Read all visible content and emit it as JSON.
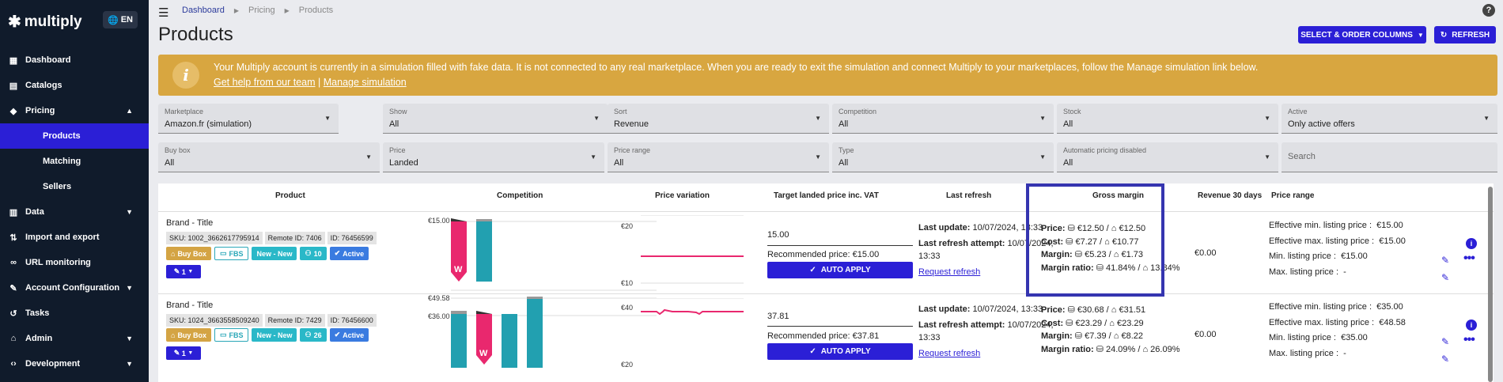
{
  "sidebar": {
    "logo": "multiply",
    "lang": "EN",
    "items": [
      {
        "label": "Dashboard",
        "icon": "dashboard-icon"
      },
      {
        "label": "Catalogs",
        "icon": "folder-icon"
      },
      {
        "label": "Pricing",
        "icon": "tag-icon"
      },
      {
        "label": "Products"
      },
      {
        "label": "Matching"
      },
      {
        "label": "Sellers"
      },
      {
        "label": "Data",
        "icon": "chart-icon"
      },
      {
        "label": "Import and export",
        "icon": "import-export-icon"
      },
      {
        "label": "URL monitoring",
        "icon": "link-icon"
      },
      {
        "label": "Account Configuration",
        "icon": "wrench-icon"
      },
      {
        "label": "Tasks",
        "icon": "history-icon"
      },
      {
        "label": "Admin",
        "icon": "bank-icon"
      },
      {
        "label": "Development",
        "icon": "code-icon"
      }
    ]
  },
  "breadcrumb": [
    "Dashboard",
    "Pricing",
    "Products"
  ],
  "page_title": "Products",
  "toolbar": {
    "select_columns": "SELECT & ORDER COLUMNS",
    "refresh": "REFRESH"
  },
  "banner": {
    "text": "Your Multiply account is currently in a simulation filled with fake data. It is not connected to any real marketplace. When you are ready to exit the simulation and connect Multiply to your marketplaces, follow the Manage simulation link below.",
    "link_help": "Get help from our team",
    "separator": "|",
    "link_manage": "Manage simulation"
  },
  "filters": [
    {
      "label": "Marketplace",
      "value": "Amazon.fr (simulation)"
    },
    {
      "label": "Show",
      "value": "All"
    },
    {
      "label": "Sort",
      "value": "Revenue"
    },
    {
      "label": "Competition",
      "value": "All"
    },
    {
      "label": "Stock",
      "value": "All"
    },
    {
      "label": "Active",
      "value": "Only active offers"
    },
    {
      "label": "Buy box",
      "value": "All"
    },
    {
      "label": "Price",
      "value": "Landed"
    },
    {
      "label": "Price range",
      "value": "All"
    },
    {
      "label": "Type",
      "value": "All"
    },
    {
      "label": "Automatic pricing disabled",
      "value": "All"
    }
  ],
  "search_placeholder": "Search",
  "columns": [
    "Product",
    "Competition",
    "Price variation",
    "Target landed price inc. VAT",
    "Last refresh",
    "Gross margin",
    "Revenue 30 days",
    "Price range"
  ],
  "rows": [
    {
      "title": "Brand - Title",
      "sku": "SKU: 1002_3662617795914",
      "remote_id": "Remote ID: 7406",
      "id": "ID: 76456599",
      "badges": {
        "buybox": "Buy Box",
        "fbs": "FBS",
        "new": "New - New",
        "count": "10",
        "active": "Active"
      },
      "tag": "1",
      "comp_axis": [
        "€15.00"
      ],
      "var_axis": [
        "€20",
        "€10"
      ],
      "target": "15.00",
      "recommended": "Recommended price: €15.00",
      "auto": "AUTO APPLY",
      "last_update_label": "Last update:",
      "last_update": "10/07/2024, 13:33",
      "last_attempt_label": "Last refresh attempt:",
      "last_attempt": "10/07/2024, 13:33",
      "request": "Request refresh",
      "margin": {
        "price_label": "Price:",
        "price": "€12.50 / ",
        "price2": "€12.50",
        "cost_label": "Cost:",
        "cost": "€7.27 / ",
        "cost2": "€10.77",
        "margin_label": "Margin:",
        "margin": "€5.23 / ",
        "margin2": "€1.73",
        "ratio_label": "Margin ratio:",
        "ratio": "41.84% / ",
        "ratio2": "13.84%"
      },
      "revenue": "€0.00",
      "range": {
        "eff_min_label": "Effective min. listing price :",
        "eff_min": "€15.00",
        "eff_max_label": "Effective max. listing price :",
        "eff_max": "€15.00",
        "min_label": "Min. listing price :",
        "min": "€15.00",
        "max_label": "Max. listing price :",
        "max": "-"
      }
    },
    {
      "title": "Brand - Title",
      "sku": "SKU: 1024_3663558509240",
      "remote_id": "Remote ID: 7429",
      "id": "ID: 76456600",
      "badges": {
        "buybox": "Buy Box",
        "fbs": "FBS",
        "new": "New - New",
        "count": "26",
        "active": "Active"
      },
      "tag": "1",
      "comp_axis": [
        "€49.58",
        "€36.00"
      ],
      "var_axis": [
        "€40",
        "€20"
      ],
      "target": "37.81",
      "recommended": "Recommended price: €37.81",
      "auto": "AUTO APPLY",
      "last_update_label": "Last update:",
      "last_update": "10/07/2024, 13:33",
      "last_attempt_label": "Last refresh attempt:",
      "last_attempt": "10/07/2024, 13:33",
      "request": "Request refresh",
      "margin": {
        "price_label": "Price:",
        "price": "€30.68 / ",
        "price2": "€31.51",
        "cost_label": "Cost:",
        "cost": "€23.29 / ",
        "cost2": "€23.29",
        "margin_label": "Margin:",
        "margin": "€7.39 / ",
        "margin2": "€8.22",
        "ratio_label": "Margin ratio:",
        "ratio": "24.09% / ",
        "ratio2": "26.09%"
      },
      "revenue": "€0.00",
      "range": {
        "eff_min_label": "Effective min. listing price :",
        "eff_min": "€35.00",
        "eff_max_label": "Effective max. listing price :",
        "eff_max": "€48.58",
        "min_label": "Min. listing price :",
        "min": "€35.00",
        "max_label": "Max. listing price :",
        "max": "-"
      }
    }
  ],
  "colors": {
    "primary": "#2b1fd6",
    "sidebar": "#101b2b",
    "banner": "#d8a640",
    "bar_pink": "#e9286e",
    "bar_teal": "#22a0b0",
    "highlight": "#3535b0"
  }
}
